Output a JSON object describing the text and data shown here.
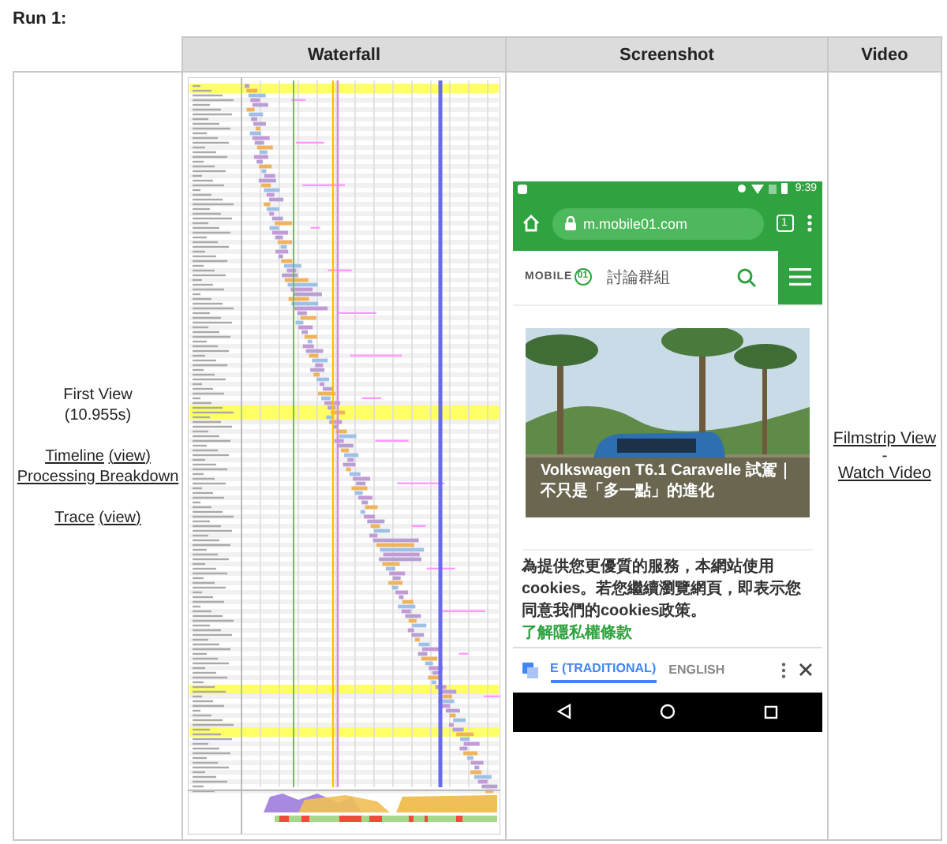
{
  "run_title": "Run 1:",
  "columns": [
    "Waterfall",
    "Screenshot",
    "Video"
  ],
  "summary": {
    "label": "First View",
    "time": "(10.955s)",
    "lines": [
      {
        "links": [
          "Timeline",
          "(view)"
        ]
      },
      {
        "links": [
          "Processing Breakdown"
        ]
      },
      {
        "links": [
          "Trace",
          "(view)"
        ]
      }
    ]
  },
  "phone": {
    "status_time": "9:39",
    "url": "m.mobile01.com",
    "tab_count": "1",
    "logo_text": "MOBILE",
    "logo_mark": "01",
    "site_section": "討論群組",
    "article_title": "Volkswagen T6.1 Caravelle 試駕｜",
    "article_subtitle": "不只是「多一點」的進化",
    "cookie_text": "為提供您更優質的服務，本網站使用cookies。若您繼續瀏覽網頁，即表示您同意我們的cookies政策。",
    "cookie_link": "了解隱私權條款",
    "translate_options": [
      {
        "label": "E (TRADITIONAL)",
        "selected": true
      },
      {
        "label": "ENGLISH",
        "selected": false
      }
    ]
  },
  "video_links": [
    "Filmstrip View",
    "-",
    "Watch Video"
  ]
}
